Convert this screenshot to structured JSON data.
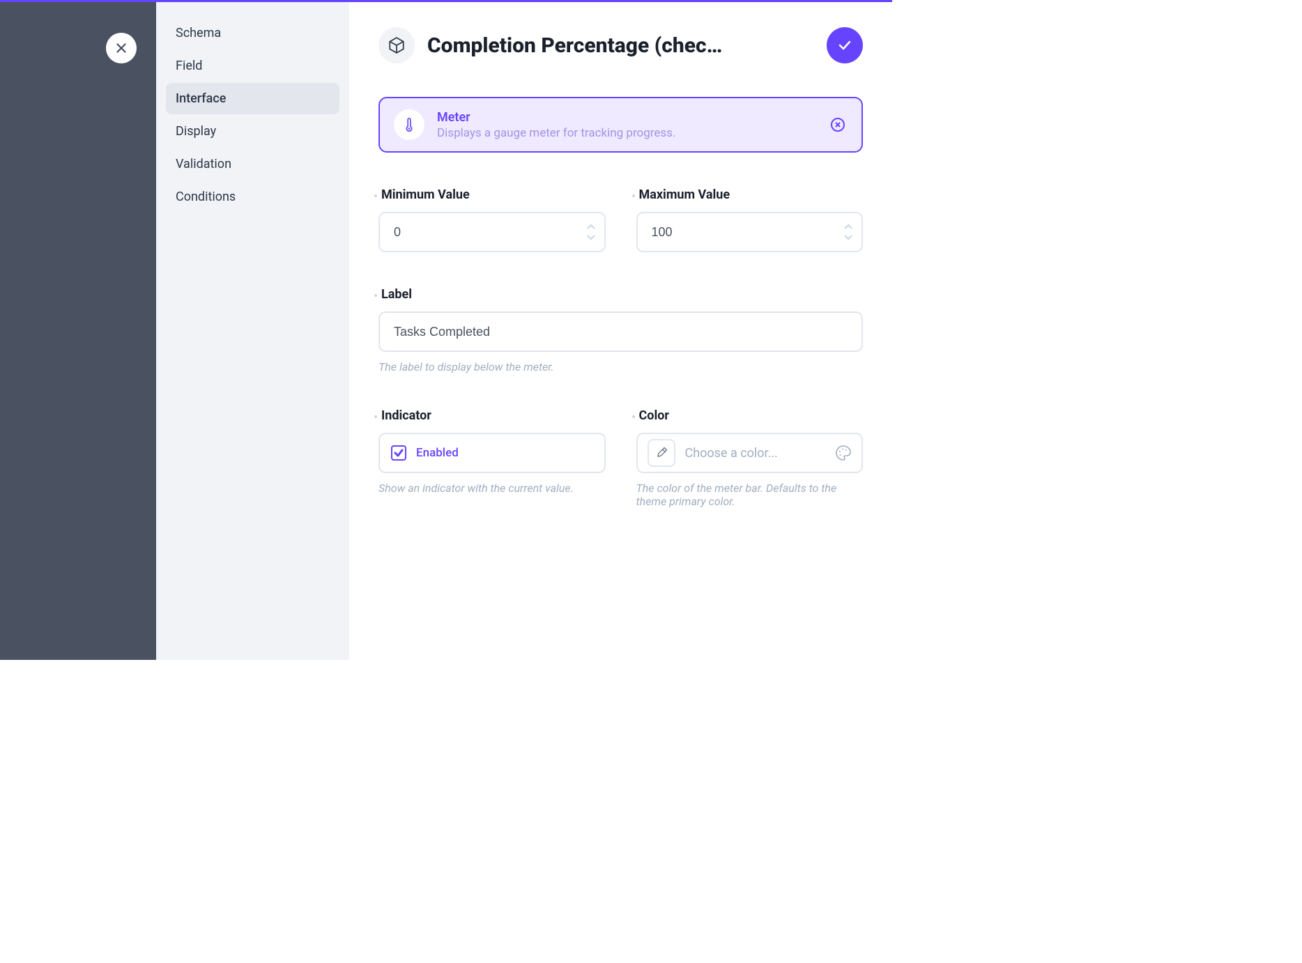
{
  "nav": {
    "items": [
      {
        "label": "Schema",
        "active": false
      },
      {
        "label": "Field",
        "active": false
      },
      {
        "label": "Interface",
        "active": true
      },
      {
        "label": "Display",
        "active": false
      },
      {
        "label": "Validation",
        "active": false
      },
      {
        "label": "Conditions",
        "active": false
      }
    ]
  },
  "header": {
    "title": "Completion Percentage (chec…"
  },
  "chip": {
    "title": "Meter",
    "description": "Displays a gauge meter for tracking progress."
  },
  "fields": {
    "min": {
      "label": "Minimum Value",
      "value": "0"
    },
    "max": {
      "label": "Maximum Value",
      "value": "100"
    },
    "label": {
      "label": "Label",
      "value": "Tasks Completed",
      "help": "The label to display below the meter."
    },
    "indicator": {
      "label": "Indicator",
      "checkbox_label": "Enabled",
      "help": "Show an indicator with the current value."
    },
    "color": {
      "label": "Color",
      "placeholder": "Choose a color...",
      "help": "The color of the meter bar. Defaults to the theme primary color."
    }
  }
}
